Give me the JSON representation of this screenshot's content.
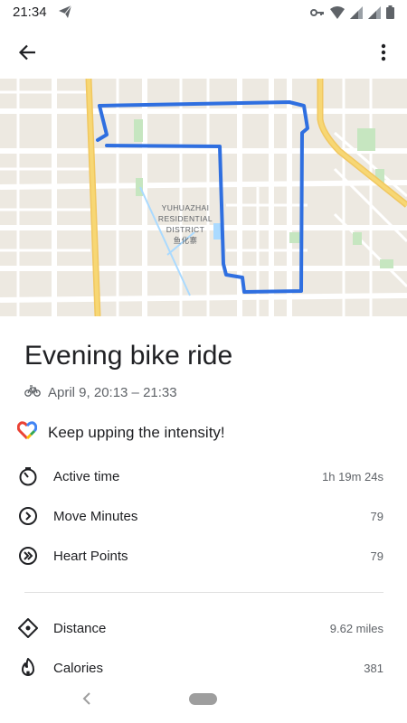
{
  "status_bar": {
    "time": "21:34",
    "icons": [
      "telegram-send-icon",
      "vpn-key-icon",
      "wifi-icon",
      "signal-icon",
      "signal-icon",
      "battery-icon"
    ]
  },
  "app_bar": {
    "back_icon": "arrow-back-icon",
    "menu_icon": "more-vert-icon"
  },
  "map": {
    "district_label_line1": "YUHUAZHAI",
    "district_label_line2": "RESIDENTIAL",
    "district_label_line3": "DISTRICT",
    "district_label_line4": "鱼化寨",
    "route_color": "#2f6fe0",
    "background_color": "#ede9e1",
    "highway_color": "#f7d774"
  },
  "activity": {
    "title": "Evening bike ride",
    "activity_icon": "bike-icon",
    "datetime": "April 9, 20:13 – 21:33"
  },
  "motivation": {
    "icon": "google-fit-heart-icon",
    "text": "Keep upping the intensity!"
  },
  "stats": [
    {
      "icon": "timer-icon",
      "label": "Active time",
      "value": "1h 19m 24s"
    },
    {
      "icon": "move-minutes-icon",
      "label": "Move Minutes",
      "value": "79"
    },
    {
      "icon": "heart-points-icon",
      "label": "Heart Points",
      "value": "79"
    }
  ],
  "details": [
    {
      "icon": "location-diamond-icon",
      "label": "Distance",
      "value": "9.62 miles"
    },
    {
      "icon": "fire-icon",
      "label": "Calories",
      "value": "381"
    }
  ],
  "nav_bar": {
    "back_icon": "nav-back-icon",
    "home_icon": "nav-home-pill"
  }
}
